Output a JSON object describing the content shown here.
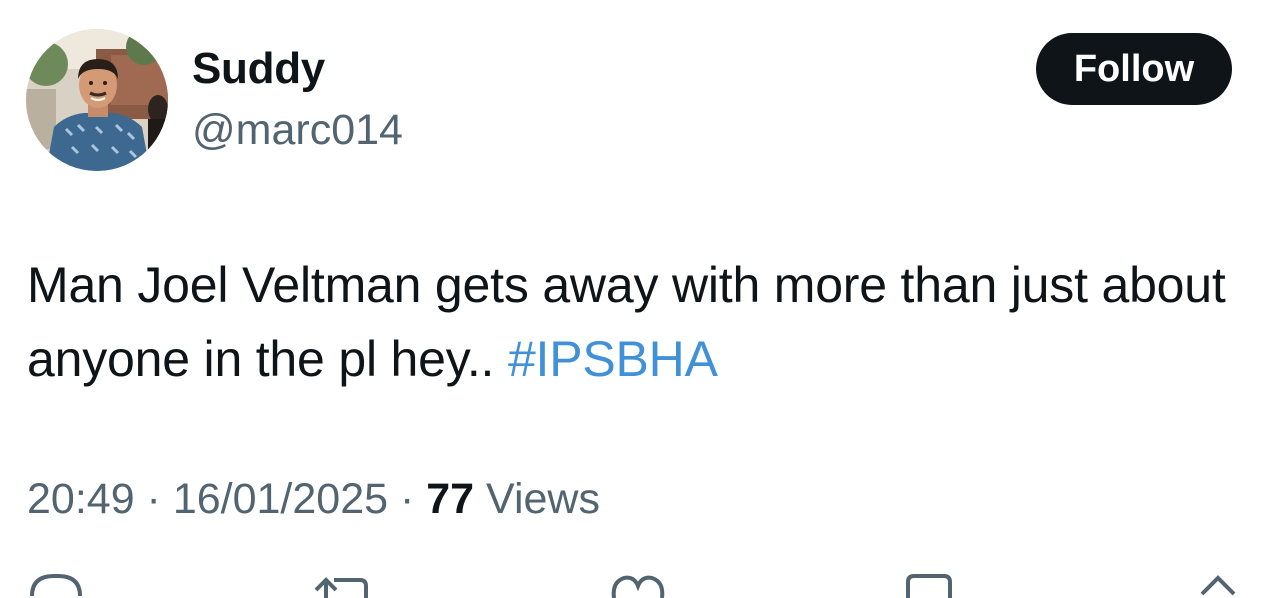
{
  "author": {
    "display_name": "Suddy",
    "handle": "@marc014"
  },
  "follow_button": {
    "label": "Follow"
  },
  "tweet": {
    "text": "Man Joel Veltman gets away with more than just about anyone in the pl hey.. ",
    "hashtag": "#IPSBHA"
  },
  "meta": {
    "time": "20:49",
    "separator": " · ",
    "date": "16/01/2025",
    "views_count": "77",
    "views_label": " Views"
  },
  "actions": [
    {
      "icon": "reply-icon"
    },
    {
      "icon": "retweet-icon"
    },
    {
      "icon": "like-icon"
    },
    {
      "icon": "bookmark-icon"
    },
    {
      "icon": "share-icon"
    }
  ],
  "colors": {
    "text": "#0f1419",
    "secondary": "#536471",
    "hashtag": "#4191d8",
    "follow_bg": "#0f1419"
  }
}
